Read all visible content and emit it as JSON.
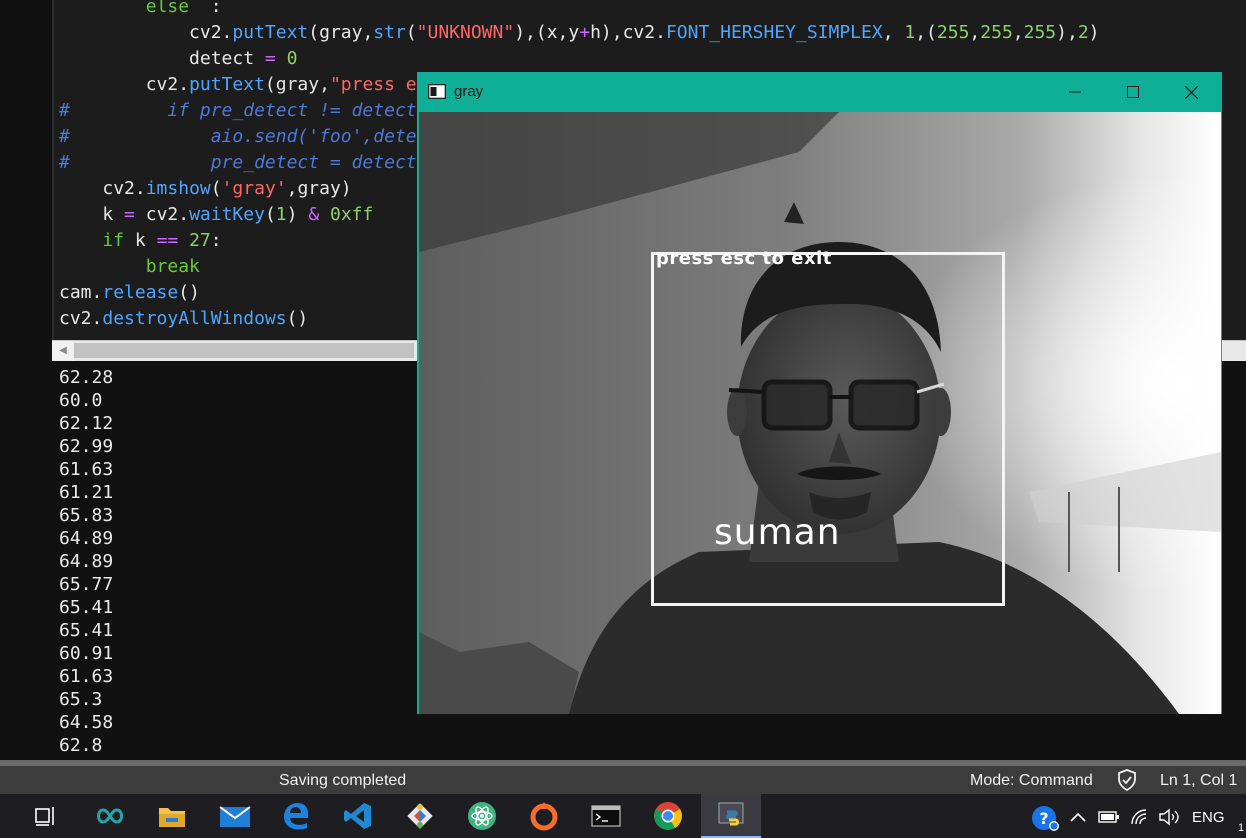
{
  "editor": {
    "lines": [
      {
        "indent": "        ",
        "parts": [
          [
            "kw",
            "else"
          ],
          [
            "",
            "  :"
          ]
        ]
      },
      {
        "indent": "            ",
        "parts": [
          [
            "",
            "cv2."
          ],
          [
            "fn",
            "putText"
          ],
          [
            "",
            "(gray,"
          ],
          [
            "fn",
            "str"
          ],
          [
            "",
            "("
          ],
          [
            "str",
            "\"UNKNOWN\""
          ],
          [
            "",
            "),(x,y"
          ],
          [
            "op",
            "+"
          ],
          [
            "",
            "h),cv2."
          ],
          [
            "fn",
            "FONT_HERSHEY_SIMPLEX"
          ],
          [
            "",
            ", "
          ],
          [
            "num",
            "1"
          ],
          [
            "",
            ",("
          ],
          [
            "num",
            "255"
          ],
          [
            "",
            ","
          ],
          [
            "num",
            "255"
          ],
          [
            "",
            ","
          ],
          [
            "num",
            "255"
          ],
          [
            "",
            "),"
          ],
          [
            "num",
            "2"
          ],
          [
            "",
            ")"
          ]
        ]
      },
      {
        "indent": "            ",
        "parts": [
          [
            "",
            "detect "
          ],
          [
            "op",
            "="
          ],
          [
            "",
            ""
          ],
          [
            "num",
            " 0"
          ]
        ]
      },
      {
        "indent": "        ",
        "parts": [
          [
            "",
            "cv2."
          ],
          [
            "fn",
            "putText"
          ],
          [
            "",
            "(gray,"
          ],
          [
            "str",
            "\"press e"
          ]
        ]
      },
      {
        "indent": "",
        "parts": [
          [
            "cmt",
            "#         if pre_detect != detect"
          ]
        ]
      },
      {
        "indent": "",
        "parts": [
          [
            "cmt",
            "#             aio.send('foo',dete"
          ]
        ]
      },
      {
        "indent": "",
        "parts": [
          [
            "cmt",
            "#             pre_detect = detect"
          ]
        ]
      },
      {
        "indent": "    ",
        "parts": [
          [
            "",
            "cv2."
          ],
          [
            "fn",
            "imshow"
          ],
          [
            "",
            "("
          ],
          [
            "str",
            "'gray'"
          ],
          [
            "",
            ",gray)"
          ]
        ]
      },
      {
        "indent": "    ",
        "parts": [
          [
            "",
            "k "
          ],
          [
            "op",
            "="
          ],
          [
            "",
            " cv2."
          ],
          [
            "fn",
            "waitKey"
          ],
          [
            "",
            "("
          ],
          [
            "num",
            "1"
          ],
          [
            "",
            ") "
          ],
          [
            "op",
            "&"
          ],
          [
            "",
            ""
          ],
          [
            "num",
            " 0xff"
          ]
        ]
      },
      {
        "indent": "    ",
        "parts": [
          [
            "kw",
            "if"
          ],
          [
            "",
            " k "
          ],
          [
            "op",
            "=="
          ],
          [
            "",
            ""
          ],
          [
            "num",
            " 27"
          ],
          [
            "",
            ":"
          ]
        ]
      },
      {
        "indent": "        ",
        "parts": [
          [
            "kw",
            "break"
          ]
        ]
      },
      {
        "indent": "",
        "parts": [
          [
            "",
            "cam."
          ],
          [
            "fn",
            "release"
          ],
          [
            "",
            "()"
          ]
        ]
      },
      {
        "indent": "",
        "parts": [
          [
            "",
            "cv2."
          ],
          [
            "fn",
            "destroyAllWindows"
          ],
          [
            "",
            "()"
          ]
        ]
      }
    ],
    "scroll_left_icon": "◀"
  },
  "console": {
    "lines": [
      "62.28",
      "60.0",
      "62.12",
      "62.99",
      "61.63",
      "61.21",
      "65.83",
      "64.89",
      "64.89",
      "65.77",
      "65.41",
      "65.41",
      "60.91",
      "61.63",
      "65.3",
      "64.58",
      "62.8"
    ]
  },
  "statusbar": {
    "message": "Saving completed",
    "mode": "Mode: Command",
    "position": "Ln 1, Col 1"
  },
  "gray_window": {
    "title": "gray",
    "overlay_text": "press esc to exit",
    "recognized_name": "suman",
    "title_color": "#0fae96"
  },
  "taskbar": {
    "apps": [
      "task-view-icon",
      "arduino-icon",
      "file-explorer-icon",
      "mail-icon",
      "edge-icon",
      "vscode-icon",
      "git-icon",
      "atom-icon",
      "origin-icon",
      "terminal-icon",
      "chrome-icon",
      "python-idle-icon"
    ],
    "language": "ENG",
    "clock_fragment": "1"
  }
}
